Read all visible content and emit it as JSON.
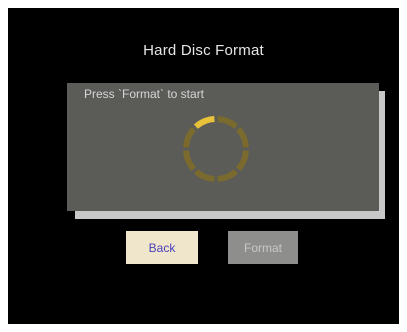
{
  "dialog": {
    "title": "Hard Disc Format",
    "message": "Press `Format` to start"
  },
  "progress": {
    "fraction": 0.2,
    "segments": 8,
    "active_segments": 1,
    "active_color": "#e7c23a",
    "inactive_color": "#7a6a2e"
  },
  "buttons": {
    "back_label": "Back",
    "format_label": "Format"
  },
  "colors": {
    "panel": "#5b5b58",
    "back_button": "#efe6cc",
    "format_button": "#8e8e8c"
  }
}
